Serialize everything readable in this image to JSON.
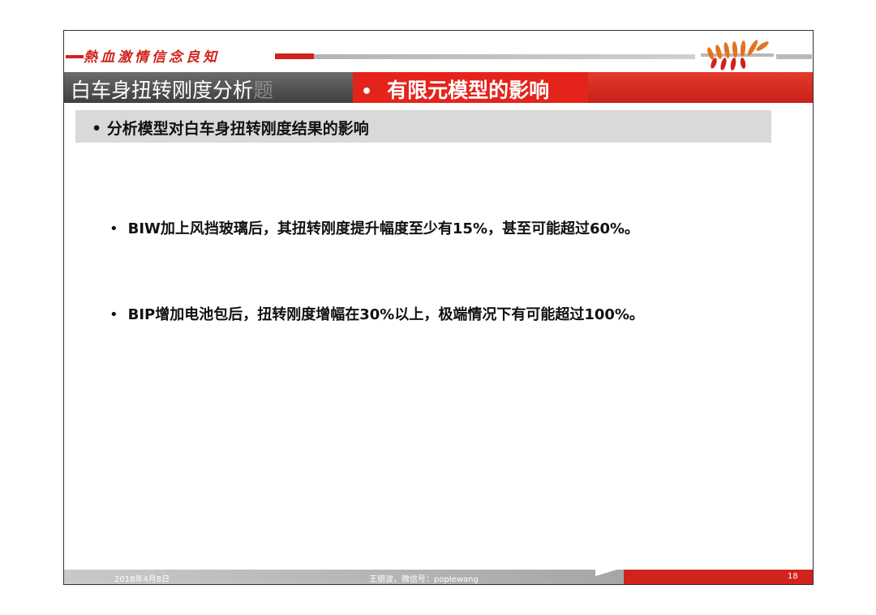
{
  "header": {
    "motto": "熱血激情信念良知"
  },
  "title": {
    "left_main": "白车身扭转刚度分析",
    "left_fade": "题",
    "bullet": "•",
    "right": "有限元模型的影响"
  },
  "subtitle": {
    "bullet": "•",
    "text": "分析模型对白车身扭转刚度结果的影响"
  },
  "bullets": [
    {
      "mark": "•",
      "text": "BIW加上风挡玻璃后，其扭转刚度提升幅度至少有15%，甚至可能超过60%。"
    },
    {
      "mark": "•",
      "text": "BIP增加电池包后，扭转刚度增幅在30%以上，极端情况下有可能超过100%。"
    }
  ],
  "footer": {
    "date": "2018年4月8日",
    "author": "王朋波，微信号：poplewang",
    "page": "18"
  },
  "colors": {
    "brand_red": "#d0231c",
    "title_gray": "#4a4a4a",
    "band_gray": "#d9d9d9"
  }
}
